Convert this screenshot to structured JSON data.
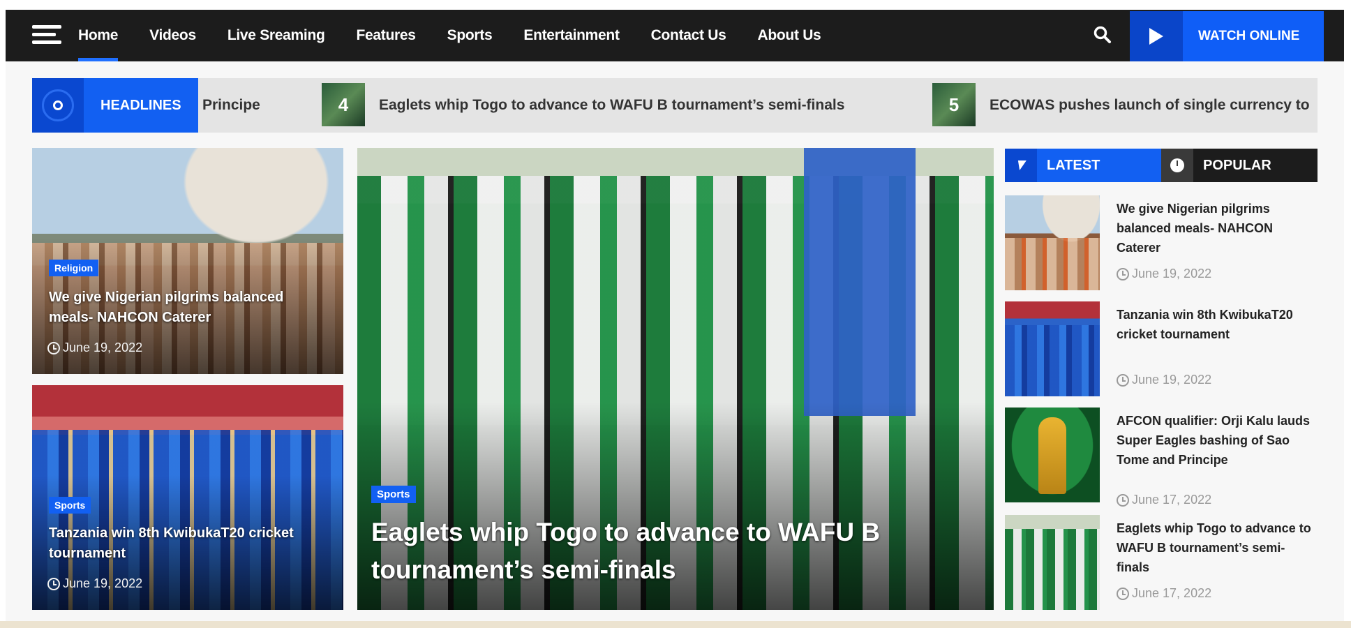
{
  "nav": {
    "items": [
      {
        "label": "Home",
        "active": true
      },
      {
        "label": "Videos"
      },
      {
        "label": "Live Sreaming"
      },
      {
        "label": "Features"
      },
      {
        "label": "Sports"
      },
      {
        "label": "Entertainment"
      },
      {
        "label": "Contact Us"
      },
      {
        "label": "About Us"
      }
    ],
    "watch_label": "WATCH ONLINE"
  },
  "ticker": {
    "label": "HEADLINES",
    "items": [
      {
        "num": "",
        "text": "Principe"
      },
      {
        "num": "4",
        "text": "Eaglets whip Togo to advance to WAFU B tournament’s semi-finals"
      },
      {
        "num": "5",
        "text": "ECOWAS pushes launch of single currency to"
      }
    ]
  },
  "cards": [
    {
      "category": "Religion",
      "title": "We give Nigerian pilgrims balanced meals- NAHCON Caterer",
      "date": "June 19, 2022"
    },
    {
      "category": "Sports",
      "title": "Tanzania win 8th KwibukaT20 cricket tournament",
      "date": "June 19, 2022"
    }
  ],
  "feature": {
    "category": "Sports",
    "title": "Eaglets whip Togo to advance to WAFU B tournament’s semi-finals"
  },
  "sidebar": {
    "tabs": {
      "latest": "LATEST",
      "popular": "POPULAR"
    },
    "items": [
      {
        "title": "We give Nigerian pilgrims balanced meals- NAHCON Caterer",
        "date": "June 19, 2022"
      },
      {
        "title": "Tanzania win 8th KwibukaT20 cricket tournament",
        "date": "June 19, 2022"
      },
      {
        "title": "AFCON qualifier: Orji Kalu lauds Super Eagles bashing of Sao Tome and Principe",
        "date": "June 17, 2022"
      },
      {
        "title": "Eaglets whip Togo to advance to WAFU B tournament’s semi-finals",
        "date": "June 17, 2022"
      }
    ]
  },
  "colors": {
    "accent": "#1260f2",
    "nav_bg": "#1c1c1c"
  },
  "icons": [
    "menu-icon",
    "search-icon",
    "play-icon",
    "headlines-icon",
    "bolt-icon",
    "clock-icon"
  ]
}
